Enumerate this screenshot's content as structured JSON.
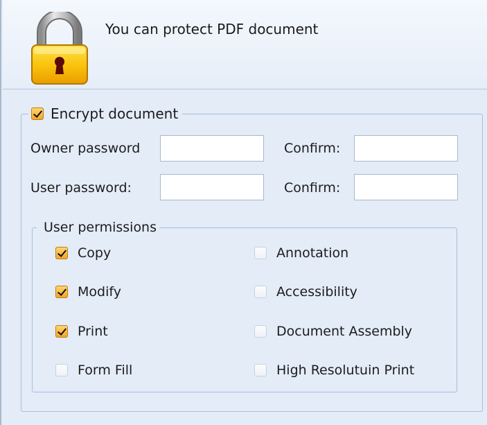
{
  "header": {
    "text": "You can protect PDF document",
    "icon": "lock-icon"
  },
  "encrypt": {
    "label": "Encrypt document",
    "checked": true,
    "owner_password_label": "Owner password",
    "owner_password_value": "",
    "owner_confirm_label": "Confirm:",
    "owner_confirm_value": "",
    "user_password_label": "User password:",
    "user_password_value": "",
    "user_confirm_label": "Confirm:",
    "user_confirm_value": ""
  },
  "permissions": {
    "title": "User permissions",
    "left": [
      {
        "label": "Copy",
        "checked": true
      },
      {
        "label": "Modify",
        "checked": true
      },
      {
        "label": "Print",
        "checked": true
      },
      {
        "label": "Form Fill",
        "checked": false
      }
    ],
    "right": [
      {
        "label": "Annotation",
        "checked": false
      },
      {
        "label": "Accessibility",
        "checked": false
      },
      {
        "label": "Document Assembly",
        "checked": false
      },
      {
        "label": "High Resolutuin Print",
        "checked": false
      }
    ]
  },
  "colors": {
    "panel_background": "#e3ecf7",
    "group_border": "#a6bfdd",
    "checkbox_checked": "#f2a52a",
    "lock_body": "#f5b800"
  }
}
